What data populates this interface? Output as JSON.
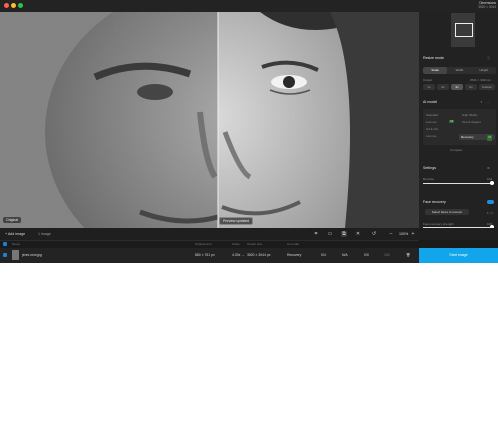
{
  "window": {
    "dimensions_line1": "Dimensions",
    "dimensions_line2": "3520 × 3044"
  },
  "viewer": {
    "original_label": "Original",
    "preview_label": "Preview updated"
  },
  "panel": {
    "resize_mode": {
      "label": "Resize mode",
      "tabs": [
        "Scale",
        "Width",
        "Height"
      ],
      "active": "Scale"
    },
    "output": {
      "label": "Output",
      "value": "3520 × 3044 px",
      "scales": [
        "1x",
        "2x",
        "4x",
        "6x",
        "Custom"
      ],
      "active": "4x"
    },
    "ai_model": {
      "label": "AI model",
      "row1_left": "Standard",
      "row1_right": "High fidelity",
      "row2_left": "Low res",
      "row2_right": "Text & shapes",
      "row3_left": "Art & CG",
      "row4_left": "Low res",
      "badge": "V2",
      "recovery_label": "Recovery",
      "recovery_badge": "V2",
      "footer": "Compare"
    },
    "settings": {
      "label": "Settings",
      "denoise_label": "Denoise",
      "denoise_value": "100"
    },
    "face_recovery": {
      "label": "Face recovery",
      "enabled": true,
      "select_button": "Select faces to recover",
      "select_count": "1 / 1",
      "strength_label": "Face recovery strength",
      "strength_value": "100"
    }
  },
  "toolbar": {
    "add_image": "Add image",
    "image_count": "1 image",
    "zoom": "100%",
    "icons": [
      "crop-icon",
      "compare-split-icon",
      "side-by-side-icon",
      "overlay-icon",
      "undo-icon"
    ]
  },
  "table": {
    "headers": [
      "Name",
      "Original size",
      "Scale",
      "Output size",
      "AI model"
    ],
    "rows": [
      {
        "name": "jenni-new.jpg",
        "original_size": "880 × 761 px",
        "scale": "4.00x",
        "scale_arrow": "→",
        "output_size": "3520 × 3044 px",
        "model": "Recovery",
        "c1": "0/4",
        "c2": "N/A",
        "c3": "0/0",
        "c4": "100"
      }
    ],
    "start_button": "Start image"
  },
  "colors": {
    "accent": "#12a5ec",
    "badge_green": "#2f6e2f",
    "toggle_blue": "#1e8fe0"
  }
}
